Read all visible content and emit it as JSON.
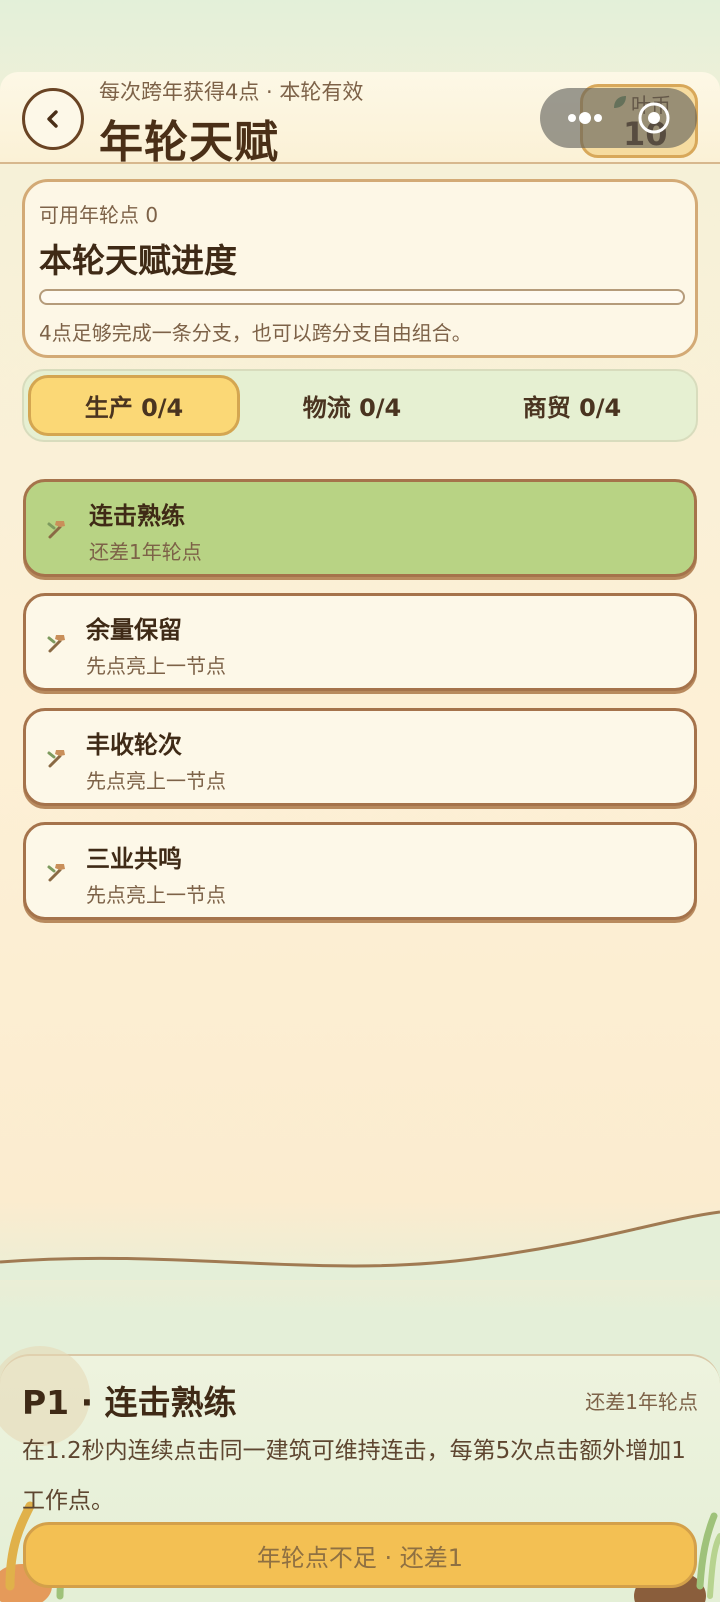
{
  "header": {
    "back_icon": "chevron-left-icon",
    "subtitle": "每次跨年获得4点 · 本轮有效",
    "title": "年轮天赋",
    "coin": {
      "label": "叶币",
      "value": "10",
      "icon": "leaf-icon"
    },
    "capsule": {
      "more_icon": "more-dots-icon",
      "close_icon": "target-circle-icon"
    }
  },
  "progress": {
    "available_label": "可用年轮点 0",
    "title": "本轮天赋进度",
    "fraction": 0,
    "hint": "4点足够完成一条分支，也可以跨分支自由组合。"
  },
  "tabs": [
    {
      "label": "生产 0/4",
      "active": true
    },
    {
      "label": "物流 0/4",
      "active": false
    },
    {
      "label": "商贸 0/4",
      "active": false
    }
  ],
  "talents": [
    {
      "name": "连击熟练",
      "status": "还差1年轮点",
      "icon": "hammer-icon",
      "current": true
    },
    {
      "name": "余量保留",
      "status": "先点亮上一节点",
      "icon": "hammer-icon",
      "current": false
    },
    {
      "name": "丰收轮次",
      "status": "先点亮上一节点",
      "icon": "hammer-icon",
      "current": false
    },
    {
      "name": "三业共鸣",
      "status": "先点亮上一节点",
      "icon": "hammer-icon",
      "current": false
    }
  ],
  "detail": {
    "title": "P1 · 连击熟练",
    "status": "还差1年轮点",
    "description": "在1.2秒内连续点击同一建筑可维持连击，每第5次点击额外增加1工作点。"
  },
  "action": {
    "label": "年轮点不足 · 还差1"
  },
  "colors": {
    "accent": "#f3c053",
    "active_tab": "#fbd876",
    "current_talent": "#b8d384",
    "card_border": "#a5734b"
  }
}
